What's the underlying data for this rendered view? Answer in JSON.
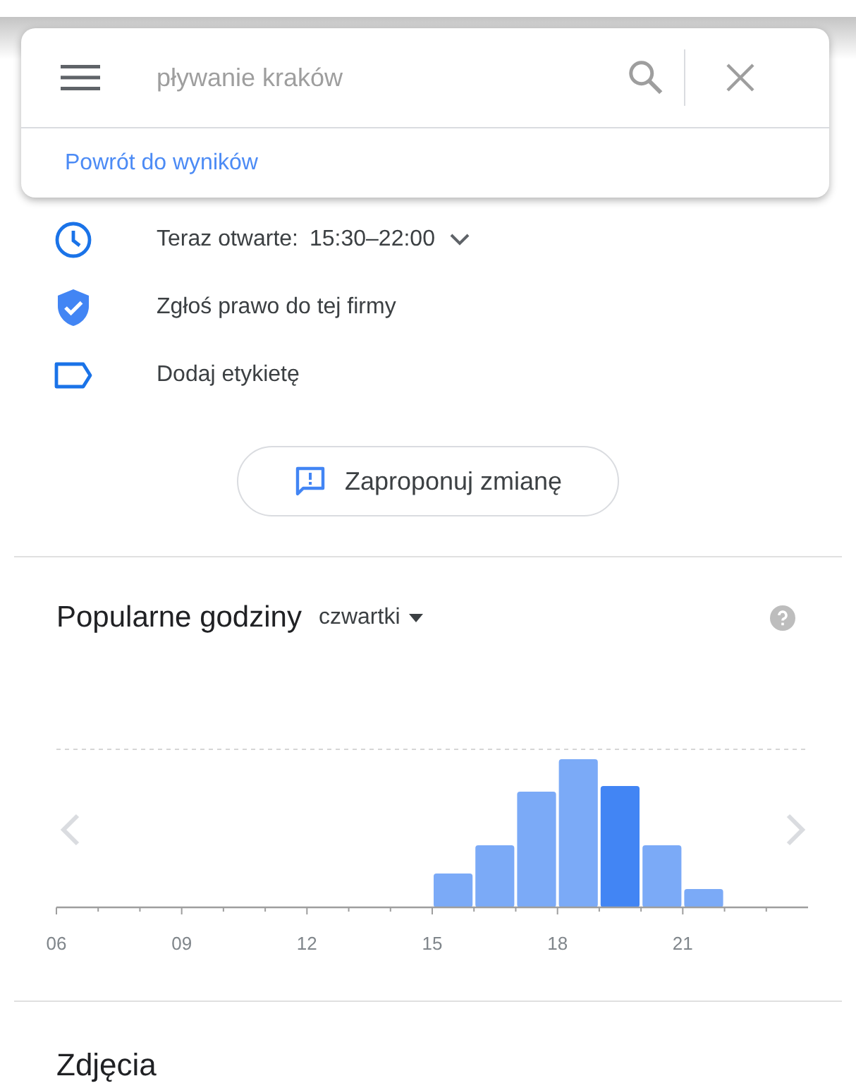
{
  "search": {
    "placeholder": "pływanie kraków"
  },
  "back_link": "Powrót do wyników",
  "info_rows": [
    {
      "kind": "hours",
      "label": "Teraz otwarte:",
      "value": "15:30–22:00",
      "expanded": false
    },
    {
      "kind": "claim",
      "label": "Zgłoś prawo do tej firmy"
    },
    {
      "kind": "tag",
      "label": "Dodaj etykietę"
    }
  ],
  "suggest_button": "Zaproponuj zmianę",
  "popular_times": {
    "title": "Popularne godziny",
    "day": "czwartki",
    "hour_labels": [
      "06",
      "09",
      "12",
      "15",
      "18",
      "21"
    ]
  },
  "photos": {
    "title": "Zdjęcia"
  }
}
